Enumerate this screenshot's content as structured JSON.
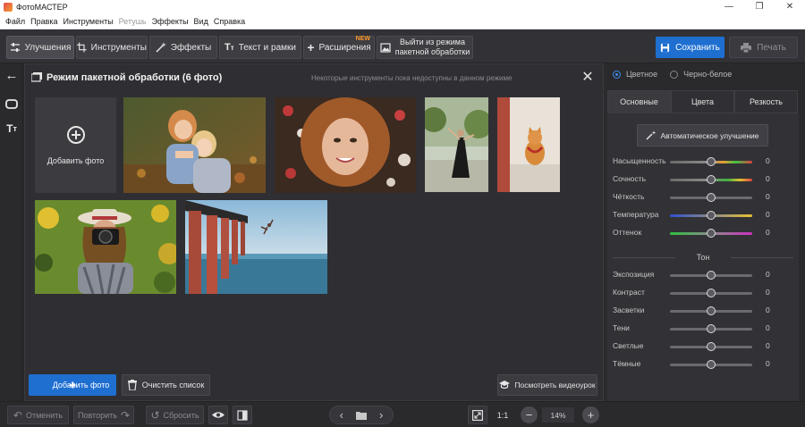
{
  "window": {
    "title": "ФотоМАСТЕР"
  },
  "menu": [
    "Файл",
    "Правка",
    "Инструменты",
    "Ретушь",
    "Эффекты",
    "Вид",
    "Справка"
  ],
  "menu_disabled": "Ретушь",
  "toolbar": {
    "improve": "Улучшения",
    "tools": "Инструменты",
    "effects": "Эффекты",
    "text": "Текст и рамки",
    "extensions": "Расширения",
    "new_badge": "NEW",
    "exit_batch_line1": "Выйти из режима",
    "exit_batch_line2": "пакетной обработки",
    "save": "Сохранить",
    "print": "Печать"
  },
  "batch": {
    "title": "Режим пакетной обработки (6 фото)",
    "notice": "Некоторые инструменты пока недоступны в данном режиме",
    "add_tile": "Добавить фото",
    "add_button": "Добавить фото",
    "clear_button": "Очистить список",
    "tutorial_button": "Посмотреть видеоурок",
    "photos": [
      "children-hugging",
      "woman-on-flowers",
      "dancer-in-park",
      "cat-on-step",
      "photographer-with-camera",
      "diver-off-pier"
    ]
  },
  "right_panel": {
    "mode_color": "Цветное",
    "mode_bw": "Черно-белое",
    "tabs": [
      "Основные",
      "Цвета",
      "Резкость"
    ],
    "auto_button": "Автоматическое улучшение",
    "sliders_top": [
      {
        "label": "Насыщенность",
        "value": "0"
      },
      {
        "label": "Сочность",
        "value": "0"
      },
      {
        "label": "Чёткость",
        "value": "0"
      },
      {
        "label": "Температура",
        "value": "0"
      },
      {
        "label": "Оттенок",
        "value": "0"
      }
    ],
    "tone_title": "Тон",
    "sliders_tone": [
      {
        "label": "Экспозиция",
        "value": "0"
      },
      {
        "label": "Контраст",
        "value": "0"
      },
      {
        "label": "Засветки",
        "value": "0"
      },
      {
        "label": "Тени",
        "value": "0"
      },
      {
        "label": "Светлые",
        "value": "0"
      },
      {
        "label": "Тёмные",
        "value": "0"
      }
    ]
  },
  "bottom": {
    "undo": "Отменить",
    "redo": "Повторить",
    "reset": "Сбросить",
    "one_to_one": "1:1",
    "zoom": "14%"
  }
}
